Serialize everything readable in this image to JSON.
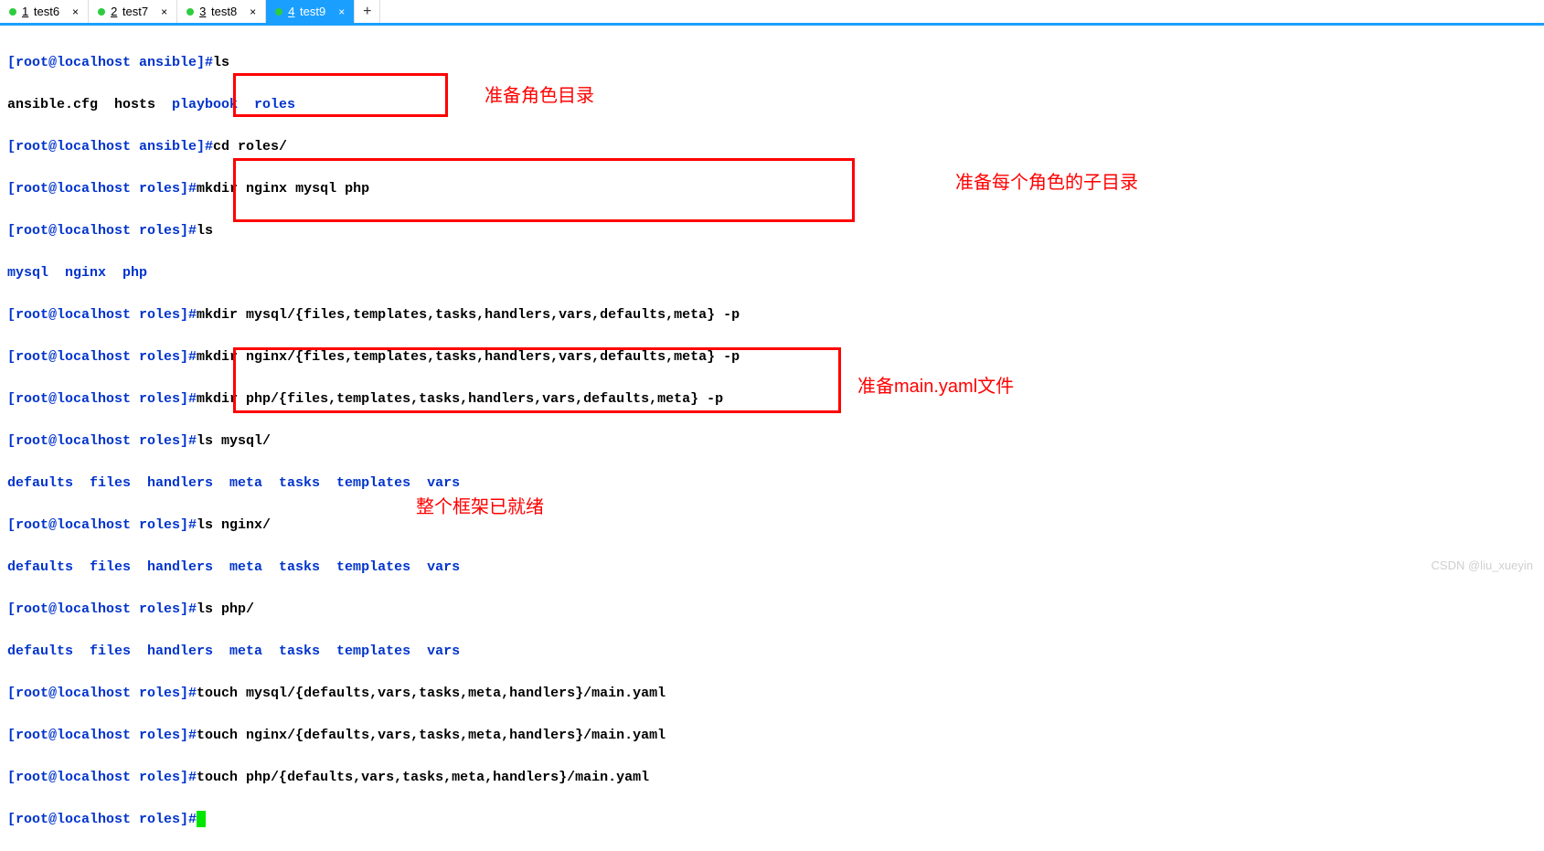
{
  "tabs": [
    {
      "num": "1",
      "label": "test6",
      "active": false
    },
    {
      "num": "2",
      "label": "test7",
      "active": false
    },
    {
      "num": "3",
      "label": "test8",
      "active": false
    },
    {
      "num": "4",
      "label": "test9",
      "active": true
    }
  ],
  "prompt_ansible": "[root@localhost ansible]#",
  "prompt_roles": "[root@localhost roles]#",
  "cmd": {
    "ls": "ls",
    "ls_out_ansible_cfg": "ansible.cfg  hosts  ",
    "ls_out_playbook_roles": "playbook  roles",
    "cd_roles": "cd roles/",
    "mkdir_nginx_mysql_php": "mkdir nginx mysql php",
    "ls_out_mysql_nginx_php": "mysql  nginx  php",
    "mkdir_mysql_sub": "mkdir mysql/{files,templates,tasks,handlers,vars,defaults,meta} -p",
    "mkdir_nginx_sub": "mkdir nginx/{files,templates,tasks,handlers,vars,defaults,meta} -p",
    "mkdir_php_sub": "mkdir php/{files,templates,tasks,handlers,vars,defaults,meta} -p",
    "ls_mysql": "ls mysql/",
    "ls_nginx": "ls nginx/",
    "ls_php": "ls php/",
    "ls_role_out": "defaults  files  handlers  meta  tasks  templates  vars",
    "touch_mysql": "touch mysql/{defaults,vars,tasks,meta,handlers}/main.yaml",
    "touch_nginx": "touch nginx/{defaults,vars,tasks,meta,handlers}/main.yaml",
    "touch_php": "touch php/{defaults,vars,tasks,meta,handlers}/main.yaml"
  },
  "annotations": {
    "a1": "准备角色目录",
    "a2": "准备每个角色的子目录",
    "a3": "准备main.yaml文件",
    "a4": "整个框架已就绪"
  },
  "watermark": "CSDN @liu_xueyin"
}
